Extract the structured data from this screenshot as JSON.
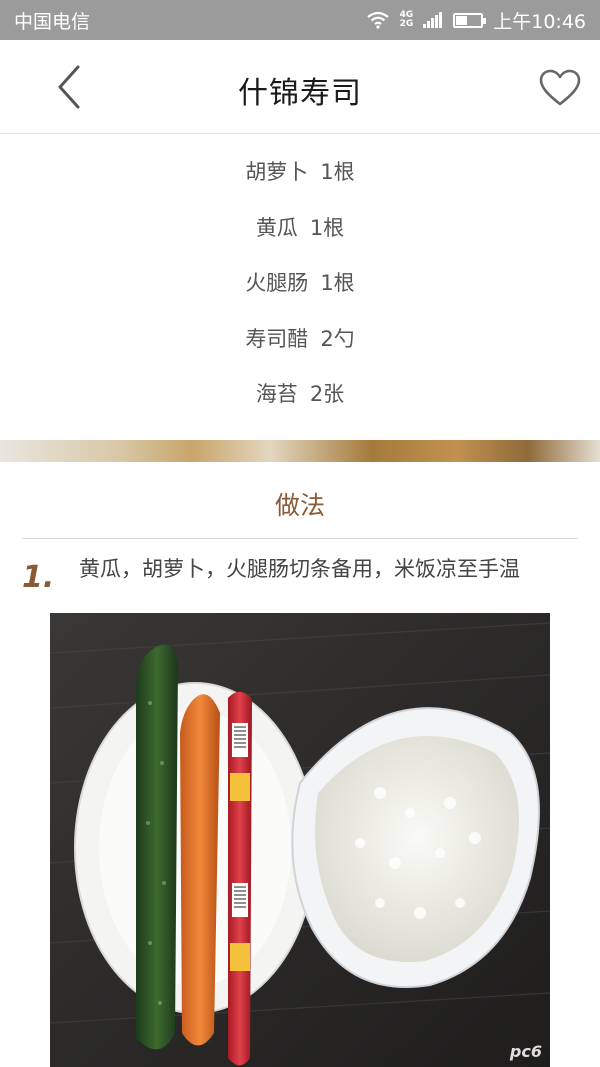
{
  "status_bar": {
    "carrier": "中国电信",
    "net_top": "4G",
    "net_bottom": "2G",
    "time": "上午10:46"
  },
  "header": {
    "title": "什锦寿司",
    "back_icon": "chevron-left-icon",
    "favorite_icon": "heart-outline-icon"
  },
  "ingredients": [
    {
      "name": "胡萝卜",
      "qty": "1根"
    },
    {
      "name": "黄瓜",
      "qty": "1根"
    },
    {
      "name": "火腿肠",
      "qty": "1根"
    },
    {
      "name": "寿司醋",
      "qty": "2勺"
    },
    {
      "name": "海苔",
      "qty": "2张"
    }
  ],
  "method": {
    "title": "做法",
    "steps": [
      {
        "number": "1.",
        "text": "黄瓜，胡萝卜，火腿肠切条备用，米饭凉至手温"
      }
    ]
  },
  "watermark": "pc6",
  "colors": {
    "accent_brown": "#8a5a36",
    "status_bar": "#9b9b9b",
    "divider": "#d8d8d8"
  }
}
